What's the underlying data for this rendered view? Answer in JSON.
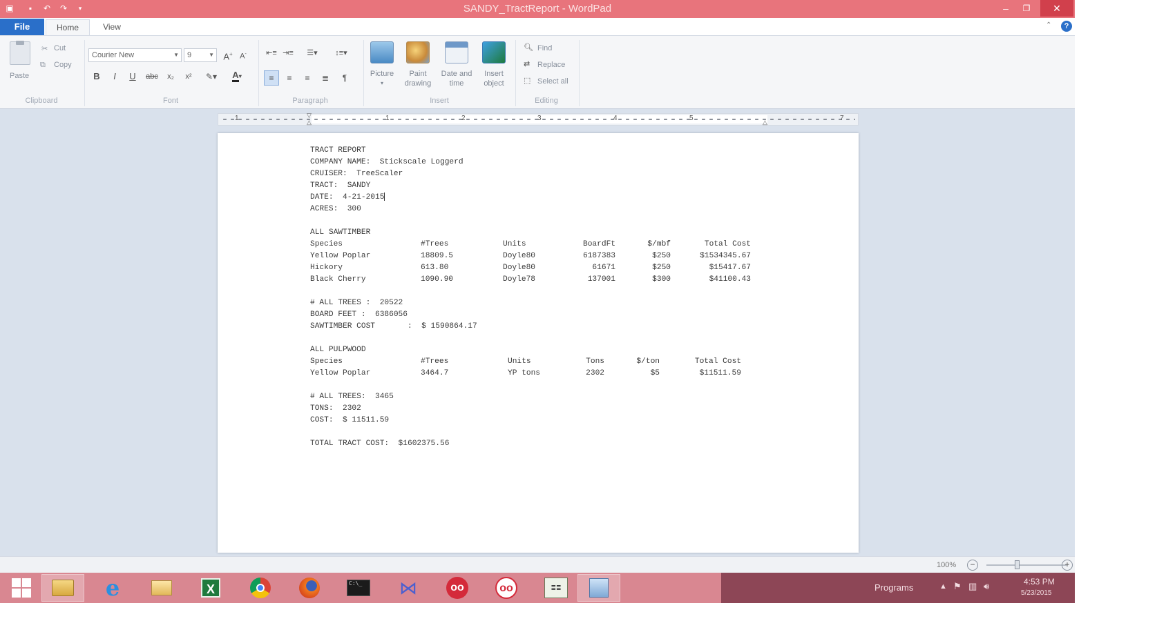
{
  "window": {
    "title": "SANDY_TractReport - WordPad",
    "controls": {
      "minimize": "–",
      "maximize": "❐",
      "close": "✕"
    }
  },
  "ribbon": {
    "file_tab": "File",
    "tabs": [
      "Home",
      "View"
    ],
    "clipboard": {
      "paste": "Paste",
      "cut": "Cut",
      "copy": "Copy",
      "group": "Clipboard"
    },
    "font": {
      "family": "Courier New",
      "size": "9",
      "group": "Font"
    },
    "paragraph": {
      "group": "Paragraph"
    },
    "insert": {
      "picture": "Picture",
      "paint_line1": "Paint",
      "paint_line2": "drawing",
      "datetime_line1": "Date and",
      "datetime_line2": "time",
      "object_line1": "Insert",
      "object_line2": "object",
      "group": "Insert"
    },
    "editing": {
      "find": "Find",
      "replace": "Replace",
      "select_all": "Select all",
      "group": "Editing"
    }
  },
  "ruler": {
    "labels": [
      "1",
      "1",
      "2",
      "3",
      "4",
      "5",
      "7"
    ]
  },
  "document": {
    "header": [
      "TRACT REPORT",
      "COMPANY NAME:  Stickscale Loggerd",
      "CRUISER:  TreeScaler",
      "TRACT:  SANDY",
      "DATE:  4-21-2015",
      "ACRES:  300"
    ],
    "sawtimber": {
      "title": "ALL SAWTIMBER",
      "columns": [
        "Species",
        "#Trees",
        "Units",
        "BoardFt",
        "$/mbf",
        "Total Cost"
      ],
      "rows": [
        [
          "Yellow Poplar",
          "18809.5",
          "Doyle80",
          "6187383",
          "$250",
          "$1534345.67"
        ],
        [
          "Hickory",
          "613.80",
          "Doyle80",
          "61671",
          "$250",
          "$15417.67"
        ],
        [
          "Black Cherry",
          "1090.90",
          "Doyle78",
          "137001",
          "$300",
          "$41100.43"
        ]
      ],
      "summary": [
        "# ALL TREES :  20522",
        "BOARD FEET :  6386056",
        "SAWTIMBER COST       :  $ 1590864.17"
      ]
    },
    "pulpwood": {
      "title": "ALL PULPWOOD",
      "columns": [
        "Species",
        "#Trees",
        "Units",
        "Tons",
        "$/ton",
        "Total Cost"
      ],
      "rows": [
        [
          "Yellow Poplar",
          "3464.7",
          "YP tons",
          "2302",
          "$5",
          "$11511.59"
        ]
      ],
      "summary": [
        "# ALL TREES:  3465",
        "TONS:  2302",
        "COST:  $ 11511.59"
      ]
    },
    "total": "TOTAL TRACT COST:  $1602375.56"
  },
  "statusbar": {
    "zoom": "100%",
    "zoom_fraction": 0.38
  },
  "taskbar": {
    "apps": [
      "windows-start-icon",
      "file-explorer-icon",
      "internet-explorer-icon",
      "folder-icon",
      "excel-icon",
      "chrome-icon",
      "firefox-icon",
      "terminal-icon",
      "network-icon",
      "media-player-icon",
      "media-player-2-icon",
      "notepad-app-icon",
      "wordpad-icon"
    ],
    "tray_label": "Programs",
    "time": "4:53 PM",
    "date": "5/23/2015"
  },
  "colors": {
    "titlebar": "#e8747c",
    "file_tab": "#2a6fc9",
    "taskbar": "#d98791",
    "tray": "#8d4656"
  }
}
